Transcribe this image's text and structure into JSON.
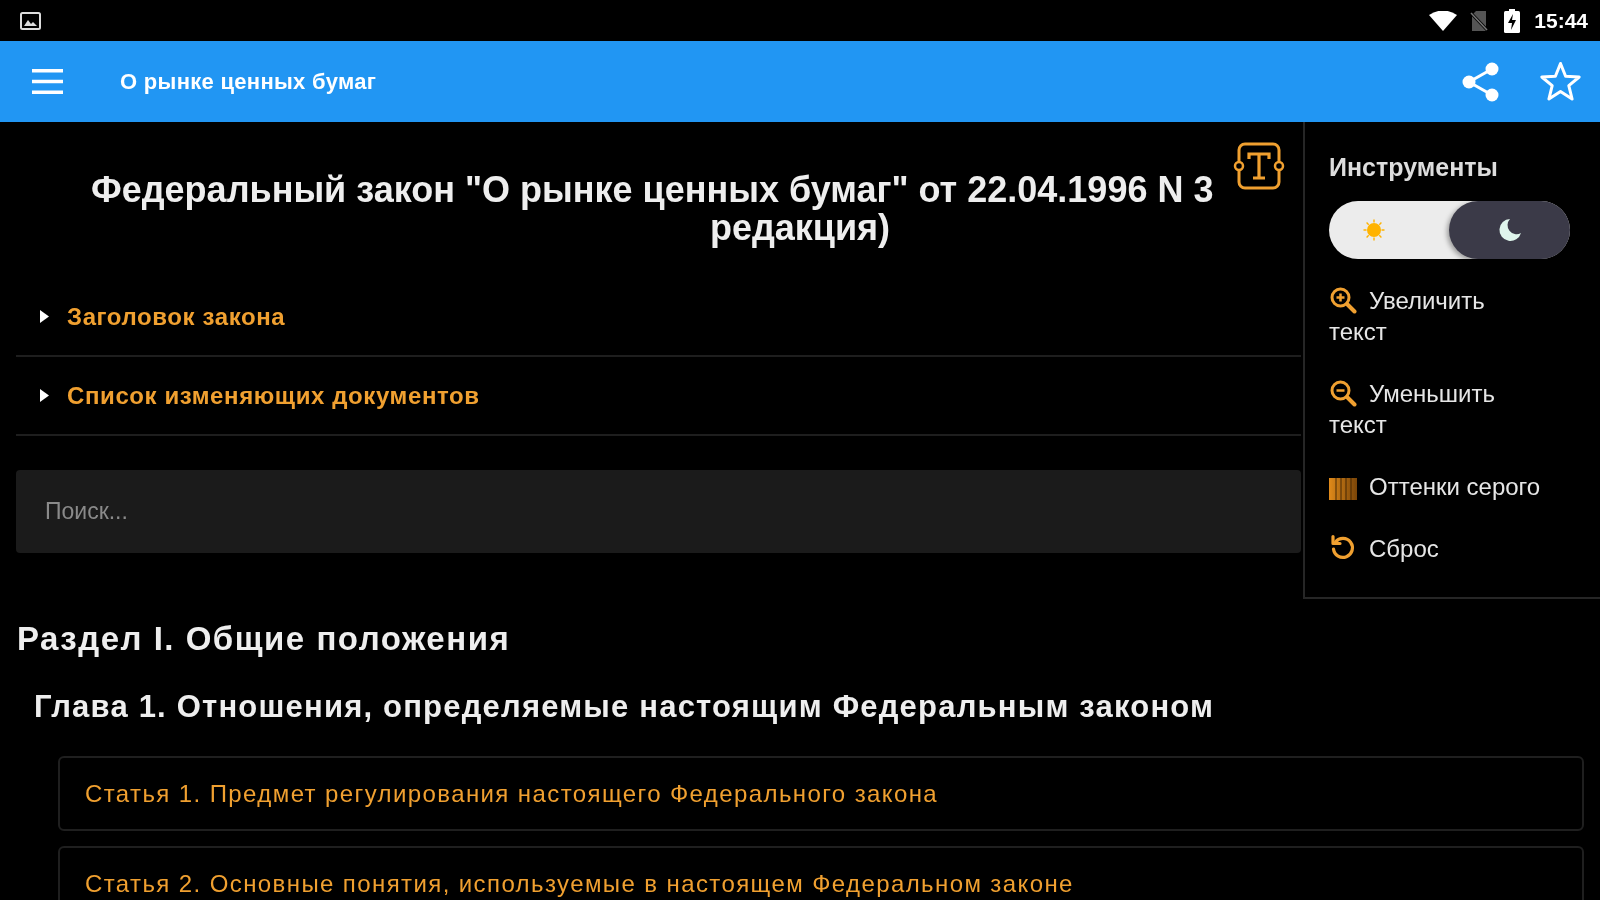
{
  "status_bar": {
    "time": "15:44"
  },
  "app_bar": {
    "title": "О рынке ценных бумаг"
  },
  "document": {
    "title_lines": [
      "Федеральный закон \"О рынке ценных бумаг\" от 22.04.1996 N 3",
      "редакция)"
    ],
    "sections": [
      {
        "label": "Заголовок закона",
        "expanded": false
      },
      {
        "label": "Список изменяющих документов",
        "expanded": false
      }
    ],
    "search": {
      "placeholder": "Поиск..."
    },
    "part_heading": "Раздел I. Общие положения",
    "chapter_heading": "Глава 1. Отношения, определяемые настоящим Федеральным законом",
    "articles": [
      "Статья 1. Предмет регулирования настоящего Федерального закона",
      "Статья 2. Основные понятия, используемые в настоящем Федеральном законе"
    ]
  },
  "tools": {
    "title": "Инструменты",
    "dark_mode": true,
    "items": [
      {
        "kind": "zoom_in",
        "label": "Увеличить текст"
      },
      {
        "kind": "zoom_out",
        "label": "Уменьшить текст"
      },
      {
        "kind": "grayscale",
        "label": "Оттенки серого"
      },
      {
        "kind": "reset",
        "label": "Сброс"
      }
    ]
  }
}
